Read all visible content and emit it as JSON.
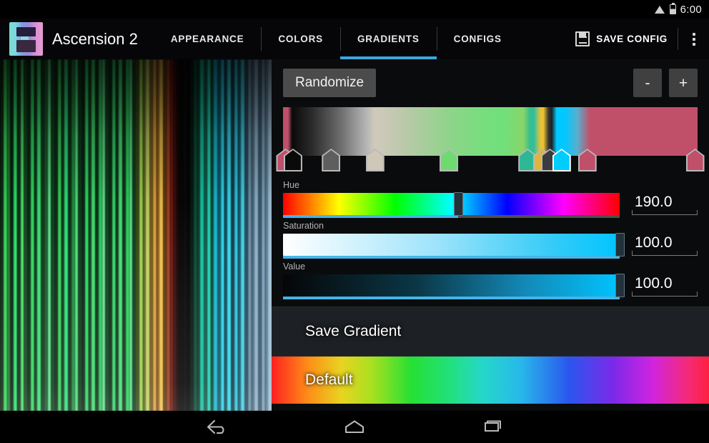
{
  "statusbar": {
    "time": "6:00",
    "icons": [
      "wifi-icon",
      "battery-icon"
    ]
  },
  "actionbar": {
    "logo_icon": "app-logo-icon",
    "app_title": "Ascension 2",
    "tabs": [
      {
        "label": "APPEARANCE",
        "active": false
      },
      {
        "label": "COLORS",
        "active": false
      },
      {
        "label": "GRADIENTS",
        "active": true
      },
      {
        "label": "CONFIGS",
        "active": false
      }
    ],
    "save_config_label": "SAVE CONFIG",
    "save_config_icon": "floppy-disk-icon",
    "overflow_icon": "overflow-menu-icon",
    "active_tab_color": "#3ba7e0"
  },
  "preview": {
    "name": "gradient-preview-render",
    "stripe_colors": [
      "#0d2a12",
      "#36d457",
      "#1f7f33",
      "#0a2410",
      "#2be06a",
      "#0e3318",
      "#49e06a",
      "#15491f",
      "#0a2a14",
      "#2fd85f",
      "#0d3a1c",
      "#3ae073",
      "#0f3a1e",
      "#1a5a2a",
      "#5de08a",
      "#12401f",
      "#0b2c14",
      "#36cf5c",
      "#0e3a1a",
      "#2ee07a",
      "#0c3318",
      "#1f8a3c",
      "#4fe07c",
      "#0f3c1d",
      "#0a2612",
      "#2bd664",
      "#113f1e",
      "#3fdc6f",
      "#0d3416",
      "#27c95c",
      "#66e08e",
      "#124420",
      "#0c2e15",
      "#33d368",
      "#103a1b",
      "#48dd78",
      "#0e3717",
      "#2ad05f",
      "#59e084",
      "#0f3e1c",
      "#394a18",
      "#9ed44e",
      "#5a6a22",
      "#c8d060",
      "#6d5d1e",
      "#e0a03a",
      "#8a5a1a",
      "#f0c04c",
      "#5e3a12",
      "#a0401c",
      "#701a12",
      "#3a0c08",
      "#120604",
      "#060606",
      "#0a0a0a",
      "#040404",
      "#061a12",
      "#0d4a36",
      "#0a3d2c",
      "#16c0a0",
      "#0e5a48",
      "#1fd0b0",
      "#0a4a3c",
      "#18b8d0",
      "#0e5a68",
      "#2ad0e8",
      "#124a58",
      "#36d8ea",
      "#0f4050",
      "#2ec2dc",
      "#14586a",
      "#40d0e4",
      "#2a4a5c",
      "#6a90a8",
      "#4a6a80",
      "#8fb0c4",
      "#3a5a70",
      "#7aa0b8",
      "#5c7c94",
      "#a0c0d4"
    ]
  },
  "editor": {
    "randomize_label": "Randomize",
    "minus_label": "-",
    "plus_label": "+",
    "gradient_strip": {
      "name": "gradient-strip",
      "css": "linear-gradient(90deg, #c0506a 0%, #c0506a 1.2%, #0a0a0a 2.2%, #2b2b2b 7%, #6e6e6e 14%, #b4b4b4 20%, #cfc9ba 22%, #cfc9ba 23%, #b8c9a8 30%, #8fd48a 40%, #78dd7e 48%, #6fe07c 53%, #8ad46a 58%, #36c08c 59.5%, #2fbfa0 60.5%, #e0c040 62%, #f0c428 62.8%, #3a3a3a 64%, #1f1f1f 64.8%, #00c8ff 66%, #00c8ff 68%, #5aaecd 71%, #c0506a 74%, #c0506a 100%)"
    },
    "stops": [
      {
        "name": "stop-0-crimson",
        "pos_pct": 0.6,
        "color": "#c0506a",
        "selected": false
      },
      {
        "name": "stop-1-black",
        "pos_pct": 2.4,
        "color": "#0a0a0b",
        "selected": false
      },
      {
        "name": "stop-2-gray",
        "pos_pct": 11.6,
        "color": "#5e5e5e",
        "selected": false
      },
      {
        "name": "stop-3-beige",
        "pos_pct": 22.2,
        "color": "#cfc8b8",
        "selected": false
      },
      {
        "name": "stop-4-green",
        "pos_pct": 40.0,
        "color": "#6ddb6f",
        "selected": false
      },
      {
        "name": "stop-5-teal",
        "pos_pct": 59.0,
        "color": "#2cb894",
        "selected": false
      },
      {
        "name": "stop-6-gold",
        "pos_pct": 62.6,
        "color": "#e0b43c",
        "selected": false
      },
      {
        "name": "stop-7-darkgray",
        "pos_pct": 64.4,
        "color": "#3c3c40",
        "selected": false
      },
      {
        "name": "stop-8-cyan",
        "pos_pct": 67.2,
        "color": "#00ccff",
        "selected": true
      },
      {
        "name": "stop-9-crimson",
        "pos_pct": 73.4,
        "color": "#c0506a",
        "selected": false
      },
      {
        "name": "stop-10-crimson",
        "pos_pct": 99.4,
        "color": "#c0506a",
        "selected": false
      }
    ],
    "sliders": [
      {
        "name": "hue",
        "label": "Hue",
        "value": "190.0",
        "fill_pct": 52,
        "track_css": "linear-gradient(90deg,#ff0000 0%,#ffff00 16.6%,#00ff00 33.3%,#00ffff 50%,#0000ff 66.6%,#ff00ff 83.3%,#ff0000 100%)"
      },
      {
        "name": "saturation",
        "label": "Saturation",
        "value": "100.0",
        "fill_pct": 100,
        "track_css": "linear-gradient(90deg,#ffffff 0%,#9fe4fb 45%,#35cbf7 80%,#00c4ff 100%)"
      },
      {
        "name": "value",
        "label": "Value",
        "value": "100.0",
        "fill_pct": 100,
        "track_css": "linear-gradient(90deg,#050607 0%,#0b3746 40%,#1389b8 72%,#00c4ff 100%)"
      }
    ],
    "rows": [
      {
        "name": "save-gradient-row",
        "label": "Save Gradient",
        "background": "#1d2024"
      },
      {
        "name": "default-gradient-row",
        "label": "Default",
        "background": "linear-gradient(90deg,#ff2020 0%,#ff8a18 8%,#e8d420 16%,#a8e020 23%,#25e034 32%,#22e07e 41%,#25d8c8 48%,#28b8ea 57%,#2a56ee 68%,#7a2ae8 78%,#d024e0 87%,#f42a7a 95%,#ff2040 100%)"
      }
    ]
  },
  "navbar": {
    "buttons": [
      {
        "name": "back-button",
        "icon": "back-arrow-icon"
      },
      {
        "name": "home-button",
        "icon": "home-icon"
      },
      {
        "name": "recents-button",
        "icon": "recents-icon"
      }
    ]
  }
}
